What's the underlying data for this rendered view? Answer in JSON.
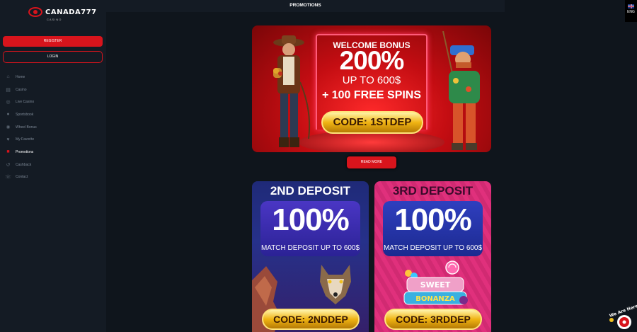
{
  "brand": {
    "name": "CANADA777",
    "tagline": "CASINO"
  },
  "header": {
    "title": "PROMOTIONS"
  },
  "language": {
    "code": "ENG"
  },
  "auth": {
    "register_label": "REGISTER",
    "login_label": "LOGIN"
  },
  "nav": {
    "items": [
      {
        "label": "Home",
        "icon": "home-icon"
      },
      {
        "label": "Casino",
        "icon": "casino-icon"
      },
      {
        "label": "Live Casino",
        "icon": "live-casino-icon"
      },
      {
        "label": "Sportsbook",
        "icon": "sportsbook-icon"
      },
      {
        "label": "Wheel Bonus",
        "icon": "wheel-icon"
      },
      {
        "label": "My Favorite",
        "icon": "heart-icon"
      },
      {
        "label": "Promotions",
        "icon": "gift-icon",
        "active": true
      },
      {
        "label": "Cashback",
        "icon": "cashback-icon"
      },
      {
        "label": "Contact",
        "icon": "contact-icon"
      }
    ]
  },
  "welcome": {
    "line1": "WELCOME BONUS",
    "line2": "200%",
    "line3": "UP TO 600$",
    "line4": "+ 100 FREE SPINS",
    "code": "CODE: 1STDEP"
  },
  "read_more_label": "READ MORE",
  "deposit_cards": [
    {
      "title": "2ND DEPOSIT",
      "percent": "100%",
      "subtitle": "MATCH DEPOSIT UP TO 600$",
      "code": "CODE: 2NDDEP"
    },
    {
      "title": "3RD DEPOSIT",
      "percent": "100%",
      "subtitle": "MATCH DEPOSIT UP TO 600$",
      "code": "CODE: 3RDDEP",
      "logo_text": "SWEET BONANZA"
    }
  ],
  "chat": {
    "label": "We Are Here!"
  },
  "colors": {
    "accent": "#d8141c",
    "sidebar": "#141b24",
    "background": "#0f151c",
    "gold": "#f0b413"
  }
}
